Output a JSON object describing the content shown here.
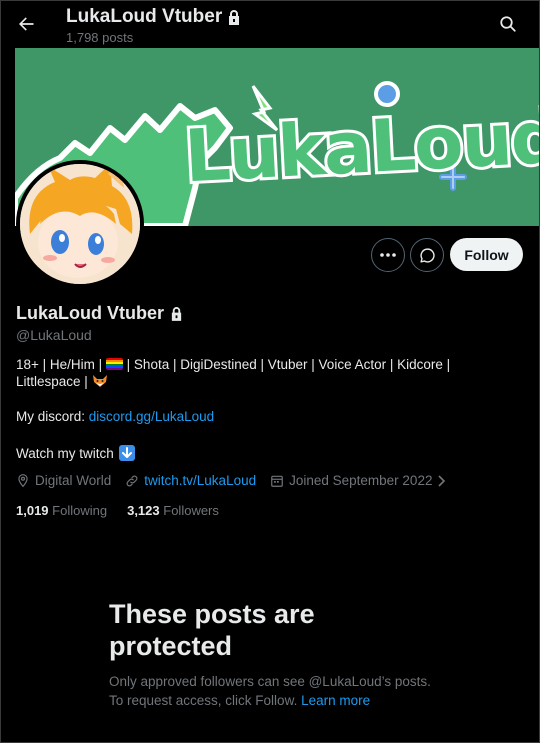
{
  "header": {
    "title": "LukaLoud Vtuber",
    "post_count": "1,798 posts"
  },
  "banner": {
    "text": "LukaLoud",
    "colors": {
      "background": "#3f9667",
      "letters_green": "#4ec07a",
      "letters_blue": "#5b9ee6",
      "outline": "#ffffff"
    }
  },
  "profile": {
    "display_name": "LukaLoud Vtuber",
    "handle": "@LukaLoud",
    "bio_part1": "18+ | He/Him | ",
    "bio_part2": " | Shota | DigiDestined | Vtuber | Voice Actor | ",
    "bio_part3": " Kidcore |",
    "bio_part4": "Littlespace | ",
    "discord_label": "My discord: ",
    "discord_link": "discord.gg/LukaLoud",
    "twitch_label": "Watch my twitch",
    "location": "Digital World",
    "website": "twitch.tv/LukaLoud",
    "joined": "Joined September 2022",
    "following_count": "1,019",
    "following_label": "Following",
    "followers_count": "3,123",
    "followers_label": "Followers"
  },
  "actions": {
    "follow_label": "Follow"
  },
  "protected_notice": {
    "heading": "These posts are protected",
    "body": "Only approved followers can see @LukaLoud’s posts. To request access, click Follow. ",
    "learn_more": "Learn more"
  },
  "colors": {
    "accent": "#1d9bf0",
    "muted": "#71767b",
    "text": "#e7e9ea",
    "background": "#000000"
  }
}
